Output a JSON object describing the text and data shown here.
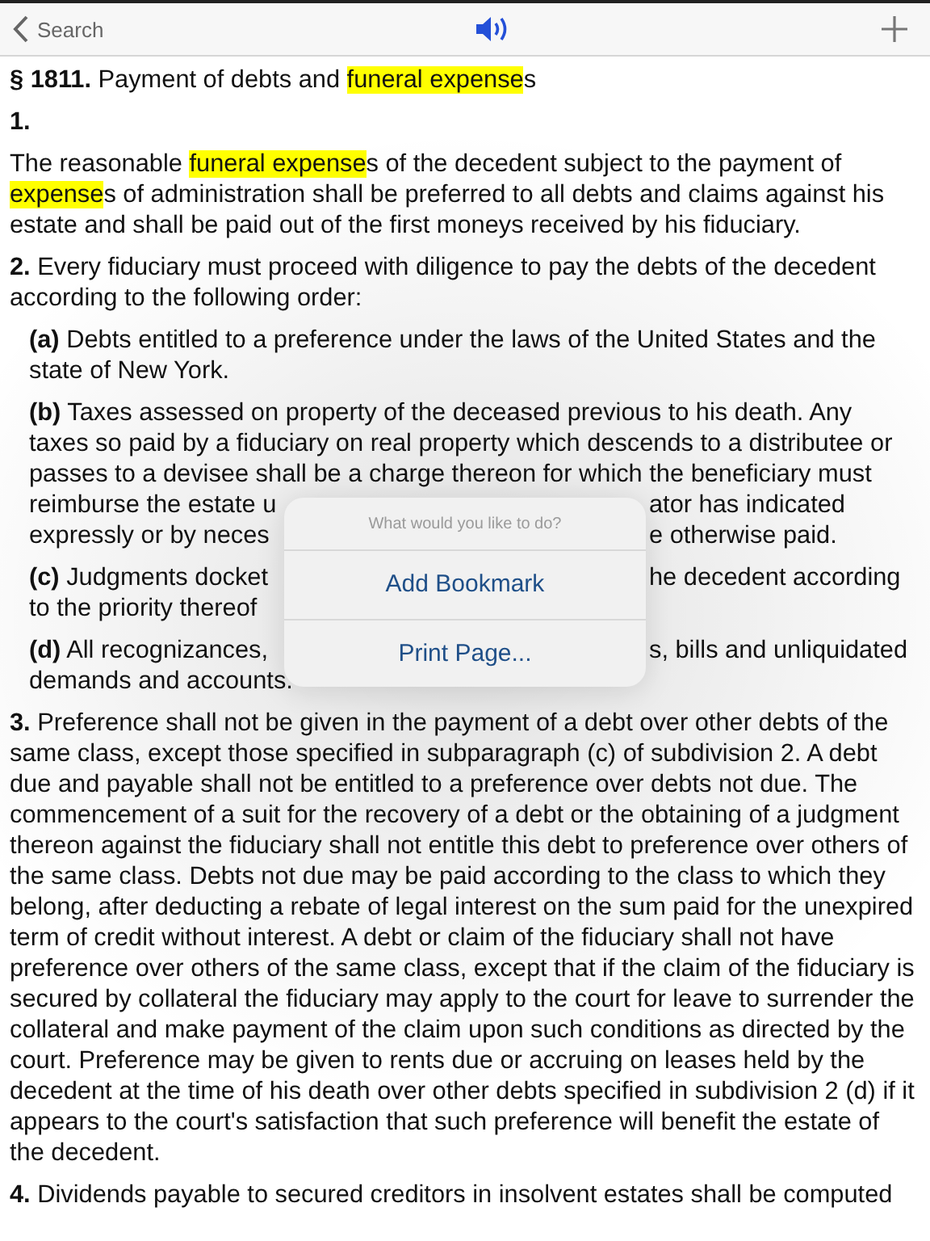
{
  "nav_bar": {
    "back_label": "Search"
  },
  "document": [
    {
      "kind": "heading",
      "parts": [
        {
          "text": "**§ 1811.** Payment of debts and ",
          "highlight": false
        },
        {
          "text": "funeral expense",
          "highlight": true
        },
        {
          "text": "s",
          "highlight": false
        }
      ]
    },
    {
      "kind": "para",
      "sub": false,
      "parts": [
        {
          "text": "**1.**",
          "highlight": false
        }
      ]
    },
    {
      "kind": "para",
      "sub": false,
      "parts": [
        {
          "text": "The reasonable ",
          "highlight": false
        },
        {
          "text": "funeral expense",
          "highlight": true
        },
        {
          "text": "s of the decedent subject to the payment of ",
          "highlight": false
        },
        {
          "text": "expense",
          "highlight": true
        },
        {
          "text": "s of administration shall be preferred to all debts and claims against his estate and shall be paid out of the first moneys received by his fiduciary.",
          "highlight": false
        }
      ]
    },
    {
      "kind": "para",
      "sub": false,
      "parts": [
        {
          "text": "**2.** Every fiduciary must proceed with diligence to pay the debts of the decedent according to the following order:",
          "highlight": false
        }
      ]
    },
    {
      "kind": "para",
      "sub": true,
      "parts": [
        {
          "text": "**(a)** Debts entitled to a preference under the laws of the United States and the state of New York.",
          "highlight": false
        }
      ]
    },
    {
      "kind": "lines",
      "sub": true,
      "lines": [
        {
          "text": "**(b)** Taxes assessed on property of the deceased previous to his death. Any"
        },
        {
          "text": "taxes so paid by a fiduciary on real property which descends to a distributee or"
        },
        {
          "text": "passes to a devisee shall be a charge thereon for which the beneficiary must"
        },
        {
          "left": "reimburse the estate u",
          "right": "ator has indicated"
        },
        {
          "left": "expressly or by neces",
          "right": "e otherwise paid."
        }
      ]
    },
    {
      "kind": "lines",
      "sub": true,
      "lines": [
        {
          "left": "**(c)** Judgments docket",
          "right": "he decedent according"
        },
        {
          "left": "to the priority thereof"
        }
      ]
    },
    {
      "kind": "lines",
      "sub": true,
      "lines": [
        {
          "left": "**(d)** All recognizances,",
          "right": "s, bills and unliquidated"
        },
        {
          "text": "demands and accounts."
        }
      ]
    },
    {
      "kind": "para",
      "sub": false,
      "parts": [
        {
          "text": "**3.** Preference shall not be given in the payment of a debt over other debts of the same class, except those specified in subparagraph (c) of subdivision 2. A debt due and payable shall not be entitled to a preference over debts not due. The commencement of a suit for the recovery of a debt or the obtaining of a judgment thereon against the fiduciary shall not entitle this debt to preference over others of the same class. Debts not due may be paid according to the class to which they belong, after deducting a rebate of legal interest on the sum paid for the unexpired term of credit without interest. A debt or claim of the fiduciary shall not have preference over others of the same class, except that if the claim of the fiduciary is secured by collateral the fiduciary may apply to the court for leave to surrender the collateral and make payment of the claim upon such conditions as directed by the court. Preference may be given to rents due or accruing on leases held by the decedent at the time of his death over other debts specified in subdivision 2 (d) if it appears to the court's satisfaction that such preference will benefit the estate of the decedent.",
          "highlight": false
        }
      ]
    },
    {
      "kind": "para",
      "sub": false,
      "parts": [
        {
          "text": "**4.** Dividends payable to secured creditors in insolvent estates shall be computed",
          "highlight": false
        }
      ]
    }
  ],
  "action_popover": {
    "title": "What would you like to do?",
    "actions": [
      "Add Bookmark",
      "Print Page..."
    ]
  }
}
